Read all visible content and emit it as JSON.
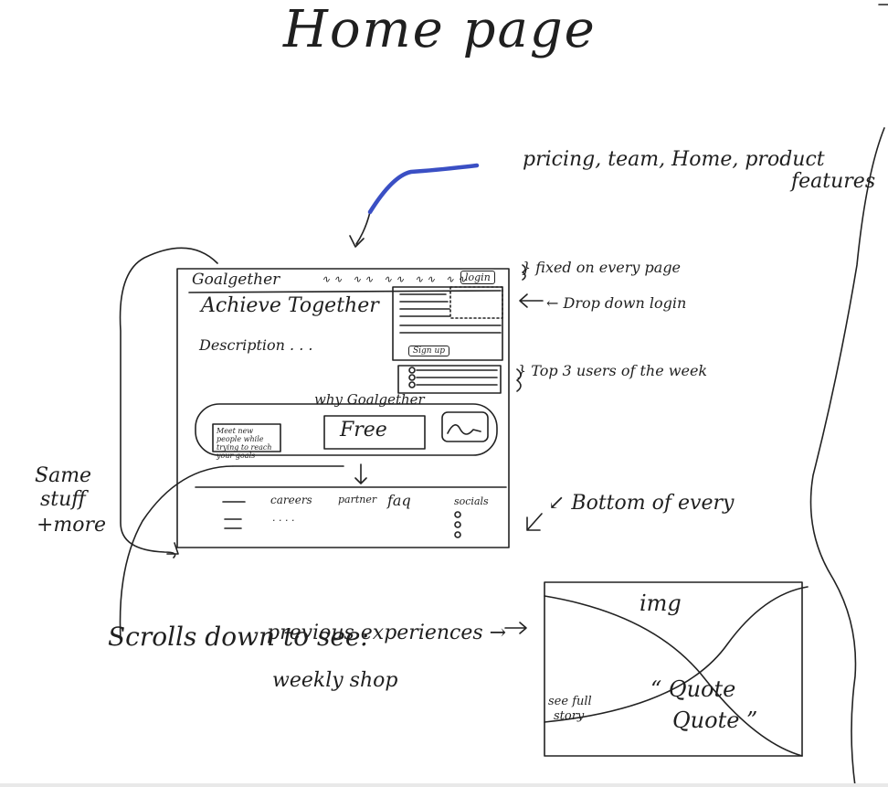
{
  "page": {
    "title": "Home page",
    "nav_note": "pricing, team, Home, product",
    "nav_note_2": "features",
    "fixed_note": "} fixed on every page",
    "dropdown_note": "← Drop down login",
    "top_users_note": "} Top 3 users of the week",
    "bottom_note": "↙ Bottom of every",
    "same_stuff_note": [
      "Same",
      "stuff",
      "+more"
    ],
    "scroll_note": "Scrolls down to see:",
    "scroll_items": [
      "previous experiences →",
      "weekly shop"
    ]
  },
  "mockup": {
    "logo": "Goalgether",
    "nav_items": [
      "∿∿",
      "∿∿",
      "∿∿",
      "∿∿",
      "∿∿"
    ],
    "login_label": "login",
    "headline": "Achieve Together",
    "description": "Description . . .",
    "signup_label": "Sign up",
    "why_label": "why Goalgether",
    "feature_meet": "Meet new people while trying to reach your goals",
    "feature_free": "Free",
    "footer": {
      "careers": "careers",
      "partner": "partner",
      "faq": "faq",
      "socials": "socials",
      "dots": ". . . ."
    }
  },
  "story_card": {
    "img_label": "img",
    "quote_line1": "“ Quote",
    "quote_line2": "Quote ”",
    "see_full_story": [
      "see full",
      "story"
    ]
  },
  "colors": {
    "ink": "#1f1f1f",
    "accent_stroke": "#3a4fc4"
  }
}
